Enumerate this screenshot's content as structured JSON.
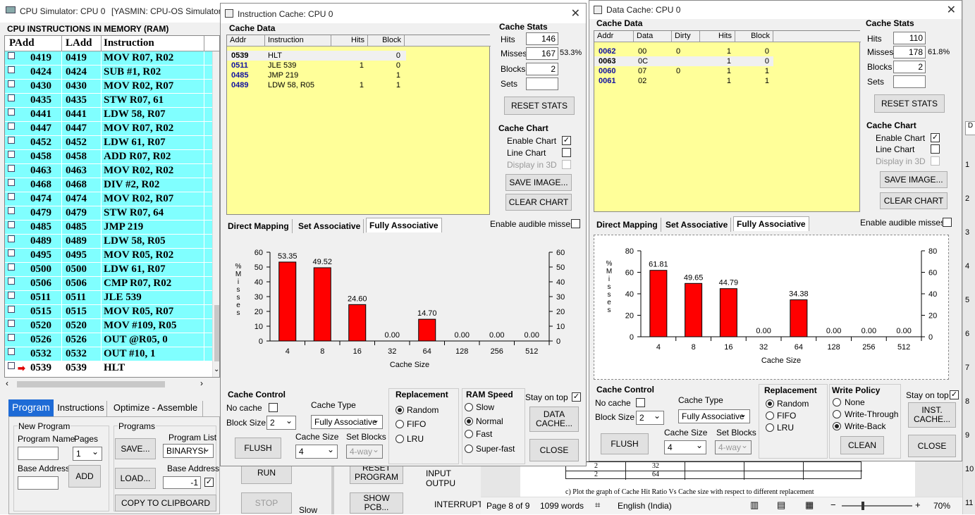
{
  "cpu_window": {
    "title": "CPU Simulator: CPU 0",
    "title_suffix": "[YASMIN: CPU-OS Simulator,",
    "mem_header": "CPU INSTRUCTIONS IN MEMORY (RAM)",
    "columns": [
      "PAdd",
      "LAdd",
      "Instruction"
    ],
    "rows": [
      {
        "padd": "0419",
        "ladd": "0419",
        "ins": "MOV R07, R02"
      },
      {
        "padd": "0424",
        "ladd": "0424",
        "ins": "SUB #1, R02"
      },
      {
        "padd": "0430",
        "ladd": "0430",
        "ins": "MOV R02, R07"
      },
      {
        "padd": "0435",
        "ladd": "0435",
        "ins": "STW R07, 61"
      },
      {
        "padd": "0441",
        "ladd": "0441",
        "ins": "LDW 58, R07"
      },
      {
        "padd": "0447",
        "ladd": "0447",
        "ins": "MOV R07, R02"
      },
      {
        "padd": "0452",
        "ladd": "0452",
        "ins": "LDW 61, R07"
      },
      {
        "padd": "0458",
        "ladd": "0458",
        "ins": "ADD R07, R02"
      },
      {
        "padd": "0463",
        "ladd": "0463",
        "ins": "MOV R02, R02"
      },
      {
        "padd": "0468",
        "ladd": "0468",
        "ins": "DIV #2, R02"
      },
      {
        "padd": "0474",
        "ladd": "0474",
        "ins": "MOV R02, R07"
      },
      {
        "padd": "0479",
        "ladd": "0479",
        "ins": "STW R07, 64"
      },
      {
        "padd": "0485",
        "ladd": "0485",
        "ins": "JMP 219"
      },
      {
        "padd": "0489",
        "ladd": "0489",
        "ins": "LDW 58, R05"
      },
      {
        "padd": "0495",
        "ladd": "0495",
        "ins": "MOV R05, R02"
      },
      {
        "padd": "0500",
        "ladd": "0500",
        "ins": "LDW 61, R07"
      },
      {
        "padd": "0506",
        "ladd": "0506",
        "ins": "CMP R07, R02"
      },
      {
        "padd": "0511",
        "ladd": "0511",
        "ins": "JLE 539"
      },
      {
        "padd": "0515",
        "ladd": "0515",
        "ins": "MOV R05, R07"
      },
      {
        "padd": "0520",
        "ladd": "0520",
        "ins": "MOV #109, R05"
      },
      {
        "padd": "0526",
        "ladd": "0526",
        "ins": "OUT @R05, 0"
      },
      {
        "padd": "0532",
        "ladd": "0532",
        "ins": "OUT #10, 1"
      },
      {
        "padd": "0539",
        "ladd": "0539",
        "ins": "HLT"
      }
    ],
    "tabs": [
      "Program",
      "Instructions",
      "Optimize - Assemble"
    ],
    "new_program": "New Program",
    "program_name": "Program Name",
    "pages": "Pages",
    "pages_value": "1",
    "base_address": "Base Address",
    "add": "ADD",
    "programs": "Programs",
    "save": "SAVE...",
    "load": "LOAD...",
    "program_list": "Program List",
    "program_list_value": "BINARYSI",
    "base_address2": "Base Address",
    "base_address_value": "-1",
    "copy": "COPY TO CLIPBOARD"
  },
  "behind": {
    "run": "RUN",
    "stop": "STOP",
    "reset": "RESET PROGRAM",
    "show_pcb": "SHOW PCB...",
    "input_output": "INPUT OUTPU",
    "interrupt": "INTERRUPT",
    "slow": "Slow",
    "table_vals": [
      [
        "2",
        "32"
      ],
      [
        "2",
        "64"
      ]
    ],
    "doc_text": "c)  Plot the graph of Cache Hit Ratio Vs Cache size with respect to different replacement",
    "status": {
      "page": "Page 8 of 9",
      "words": "1099 words",
      "lang": "English (India)",
      "zoom": "70%"
    },
    "ruler": [
      "1",
      "2",
      "3",
      "4",
      "5",
      "6",
      "7",
      "8",
      "9",
      "10",
      "11"
    ]
  },
  "icache": {
    "title": "Instruction Cache: CPU 0",
    "cache_data": "Cache Data",
    "columns": [
      "Addr",
      "Instruction",
      "Hits",
      "Block"
    ],
    "rows": [
      {
        "addr": "0539",
        "data": "HLT",
        "hits": "",
        "block": "0",
        "sel": true
      },
      {
        "addr": "0511",
        "data": "JLE 539",
        "hits": "1",
        "block": "0"
      },
      {
        "addr": "0485",
        "data": "JMP 219",
        "hits": "",
        "block": "1"
      },
      {
        "addr": "0489",
        "data": "LDW 58, R05",
        "hits": "1",
        "block": "1"
      }
    ],
    "stats_title": "Cache Stats",
    "hits_label": "Hits",
    "hits": "146",
    "misses_label": "Misses",
    "misses": "167",
    "miss_pct": "53.3%",
    "blocks_label": "Blocks",
    "blocks": "2",
    "sets_label": "Sets",
    "sets": "",
    "reset_stats": "RESET STATS",
    "chart_title": "Cache Chart",
    "enable_chart": "Enable Chart",
    "line_chart": "Line Chart",
    "display_3d": "Display in 3D",
    "save_image": "SAVE IMAGE...",
    "clear_chart": "CLEAR CHART",
    "tabs": [
      "Direct Mapping",
      "Set Associative",
      "Fully Associative"
    ],
    "audible": "Enable audible misses",
    "control_title": "Cache Control",
    "no_cache": "No cache",
    "cache_type": "Cache Type",
    "cache_type_value": "Fully Associative",
    "block_size": "Block Size",
    "block_size_value": "2",
    "flush": "FLUSH",
    "cache_size": "Cache Size",
    "cache_size_value": "4",
    "set_blocks": "Set Blocks",
    "set_blocks_value": "4-way",
    "replacement": "Replacement",
    "repl_options": [
      "Random",
      "FIFO",
      "LRU"
    ],
    "ram_speed": "RAM Speed",
    "speed_options": [
      "Slow",
      "Normal",
      "Fast",
      "Super-fast"
    ],
    "stay_on_top": "Stay on top",
    "data_cache_btn": "DATA CACHE...",
    "close": "CLOSE"
  },
  "dcache": {
    "title": "Data Cache: CPU 0",
    "cache_data": "Cache Data",
    "columns": [
      "Addr",
      "Data",
      "Dirty",
      "Hits",
      "Block"
    ],
    "rows": [
      {
        "addr": "0062",
        "data": "00",
        "dirty": "0",
        "hits": "1",
        "block": "0"
      },
      {
        "addr": "0063",
        "data": "0C",
        "dirty": "",
        "hits": "1",
        "block": "0",
        "sel": true
      },
      {
        "addr": "0060",
        "data": "07",
        "dirty": "0",
        "hits": "1",
        "block": "1"
      },
      {
        "addr": "0061",
        "data": "02",
        "dirty": "",
        "hits": "1",
        "block": "1"
      }
    ],
    "stats_title": "Cache Stats",
    "hits_label": "Hits",
    "hits": "110",
    "misses_label": "Misses",
    "misses": "178",
    "miss_pct": "61.8%",
    "blocks_label": "Blocks",
    "blocks": "2",
    "sets_label": "Sets",
    "sets": "",
    "reset_stats": "RESET STATS",
    "chart_title": "Cache Chart",
    "enable_chart": "Enable Chart",
    "line_chart": "Line Chart",
    "display_3d": "Display in 3D",
    "save_image": "SAVE IMAGE...",
    "clear_chart": "CLEAR CHART",
    "tabs": [
      "Direct Mapping",
      "Set Associative",
      "Fully Associative"
    ],
    "audible": "Enable audible misses",
    "control_title": "Cache Control",
    "no_cache": "No cache",
    "cache_type": "Cache Type",
    "cache_type_value": "Fully Associative",
    "block_size": "Block Size",
    "block_size_value": "2",
    "flush": "FLUSH",
    "cache_size": "Cache Size",
    "cache_size_value": "4",
    "set_blocks": "Set Blocks",
    "set_blocks_value": "4-way",
    "replacement": "Replacement",
    "repl_options": [
      "Random",
      "FIFO",
      "LRU"
    ],
    "write_policy": "Write Policy",
    "write_options": [
      "None",
      "Write-Through",
      "Write-Back"
    ],
    "clean": "CLEAN",
    "stay_on_top": "Stay on top",
    "inst_cache_btn": "INST. CACHE...",
    "close": "CLOSE"
  },
  "chart_data": [
    {
      "type": "bar",
      "categories": [
        "4",
        "8",
        "16",
        "32",
        "64",
        "128",
        "256",
        "512"
      ],
      "values": [
        53.35,
        49.52,
        24.6,
        0.0,
        14.7,
        0.0,
        0.0,
        0.0
      ],
      "labels": [
        "53.35",
        "49.52",
        "24.60",
        "0.00",
        "14.70",
        "0.00",
        "0.00",
        "0.00"
      ],
      "xlabel": "Cache Size",
      "ylabel": "% Misses",
      "ylim": [
        0,
        60
      ],
      "yticks": [
        "0",
        "10",
        "20",
        "30",
        "40",
        "50",
        "60"
      ],
      "bar_color": "#ff0000"
    },
    {
      "type": "bar",
      "categories": [
        "4",
        "8",
        "16",
        "32",
        "64",
        "128",
        "256",
        "512"
      ],
      "values": [
        61.81,
        49.65,
        44.79,
        0.0,
        34.38,
        0.0,
        0.0,
        0.0
      ],
      "labels": [
        "61.81",
        "49.65",
        "44.79",
        "0.00",
        "34.38",
        "0.00",
        "0.00",
        "0.00"
      ],
      "xlabel": "Cache Size",
      "ylabel": "% Misses",
      "ylim": [
        0,
        80
      ],
      "yticks": [
        "0",
        "20",
        "40",
        "60",
        "80"
      ],
      "bar_color": "#ff0000"
    }
  ]
}
